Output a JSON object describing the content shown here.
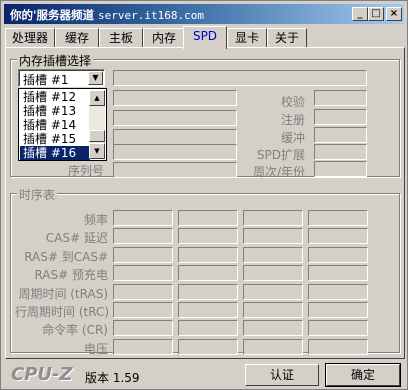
{
  "window": {
    "title": "你的'服务器频道",
    "title_url": "server.it168.com",
    "min_label": "_",
    "max_label": "□",
    "close_label": "×"
  },
  "tabs": [
    {
      "label": "处理器",
      "active": false
    },
    {
      "label": "缓存",
      "active": false
    },
    {
      "label": "主板",
      "active": false
    },
    {
      "label": "内存",
      "active": false
    },
    {
      "label": "SPD",
      "active": true
    },
    {
      "label": "显卡",
      "active": false
    },
    {
      "label": "关于",
      "active": false
    }
  ],
  "slot_group": {
    "title": "内存插槽选择",
    "selected": "插槽 #1",
    "dropdown_items": [
      "插槽 #12",
      "插槽 #13",
      "插槽 #14",
      "插槽 #15",
      "插槽 #16"
    ],
    "highlighted_item": "插槽 #16",
    "right_labels": [
      "校验",
      "注册",
      "缓冲",
      "SPD扩展",
      "周次/年份"
    ],
    "serial_label": "序列号"
  },
  "timing_group": {
    "title": "时序表",
    "rows": [
      "频率",
      "CAS# 延迟",
      "RAS# 到CAS#",
      "RAS# 预充电",
      "周期时间 (tRAS)",
      "行周期时间 (tRC)",
      "命令率 (CR)",
      "电压"
    ]
  },
  "footer": {
    "logo": "CPU-Z",
    "version": "版本 1.59",
    "validate_button": "认证",
    "ok_button": "确定"
  },
  "colors": {
    "face": "#d4d0c8",
    "title_start": "#0a246a",
    "title_end": "#a6caf0",
    "active_tab_text": "#0000c0",
    "label_gray": "#7f7f7f"
  }
}
